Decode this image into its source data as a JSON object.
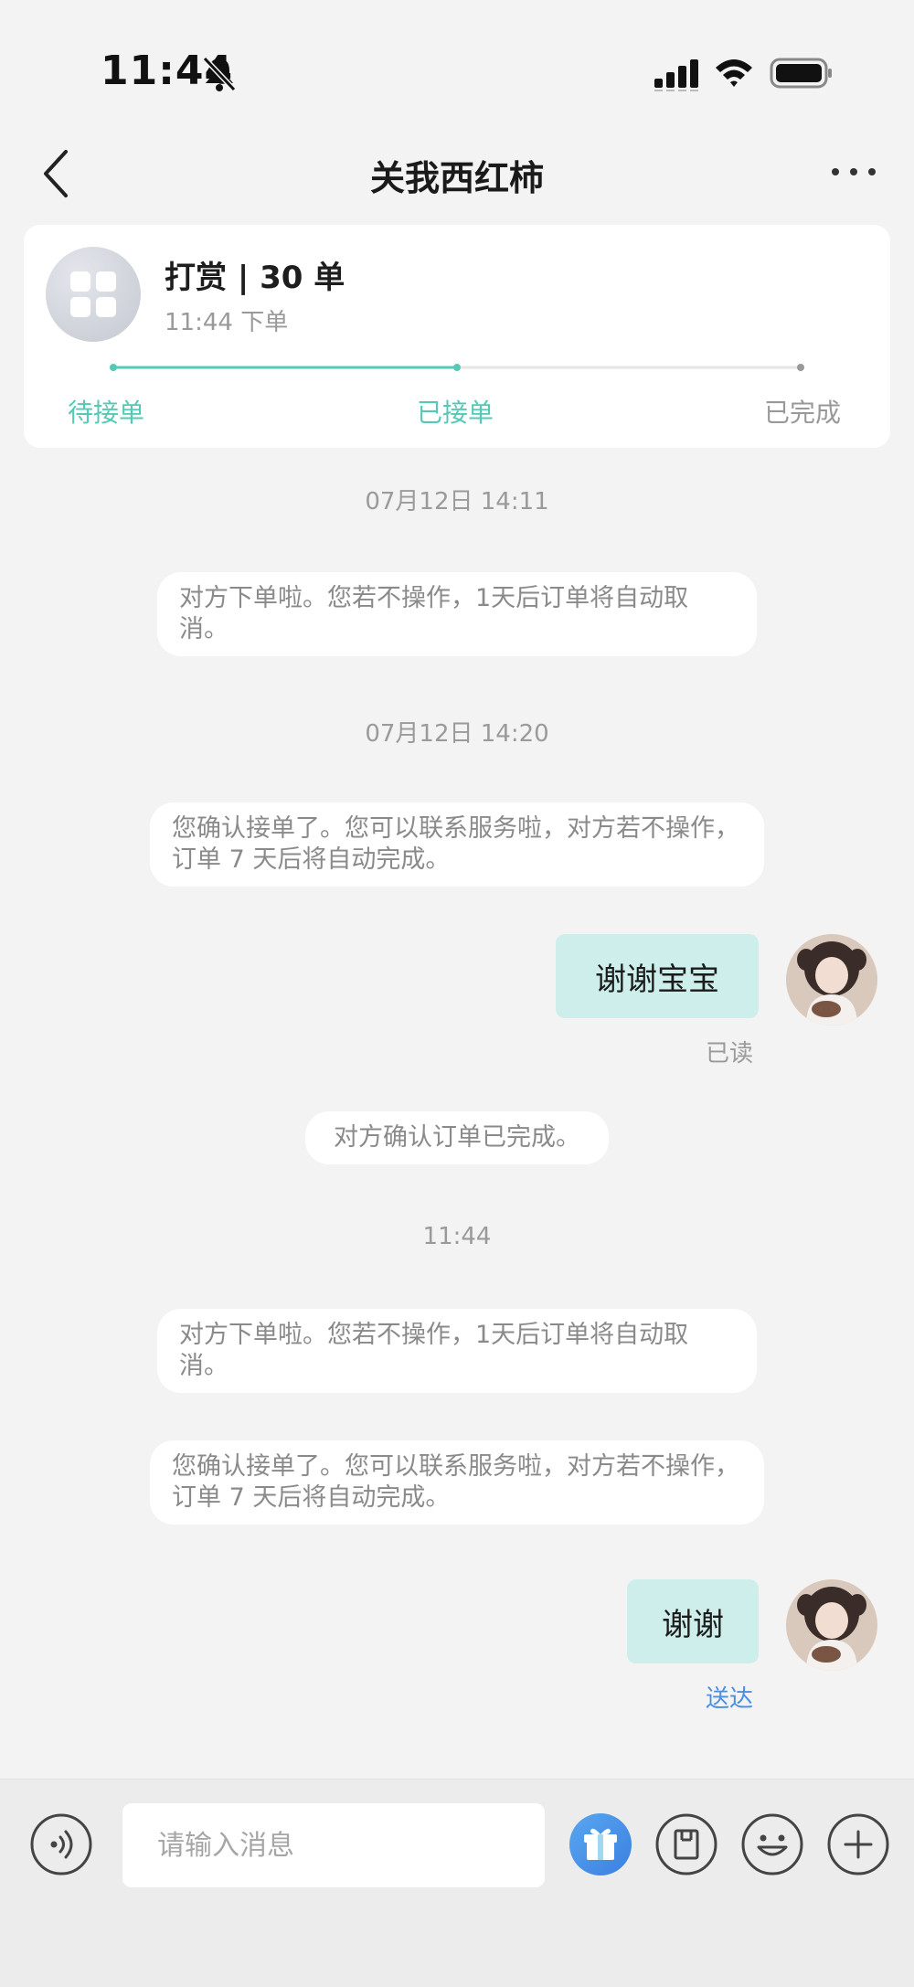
{
  "status_bar": {
    "time": "11:44"
  },
  "nav": {
    "title": "关我西红柿"
  },
  "order_card": {
    "title": "打赏 | 30 单",
    "subtitle": "11:44 下单",
    "steps": [
      {
        "label": "待接单",
        "state": "done"
      },
      {
        "label": "已接单",
        "state": "current"
      },
      {
        "label": "已完成",
        "state": "pending"
      }
    ],
    "progress_fraction": 0.5,
    "accent_color": "#55c8b6"
  },
  "chat": {
    "time_1": "07月12日 14:11",
    "sys_1": "对方下单啦。您若不操作，1天后订单将自动取消。",
    "time_2": "07月12日 14:20",
    "sys_2": "您确认接单了。您可以联系服务啦，对方若不操作，订单 7 天后将自动完成。",
    "msg_1": {
      "text": "谢谢宝宝",
      "status": "已读"
    },
    "sys_3": "对方确认订单已完成。",
    "time_3": "11:44",
    "sys_4": "对方下单啦。您若不操作，1天后订单将自动取消。",
    "sys_5": "您确认接单了。您可以联系服务啦，对方若不操作，订单 7 天后将自动完成。",
    "msg_2": {
      "text": "谢谢",
      "status": "送达"
    }
  },
  "input_bar": {
    "placeholder": "请输入消息",
    "icons": [
      "voice-icon",
      "gift-icon",
      "order-icon",
      "emoji-icon",
      "plus-icon"
    ]
  }
}
